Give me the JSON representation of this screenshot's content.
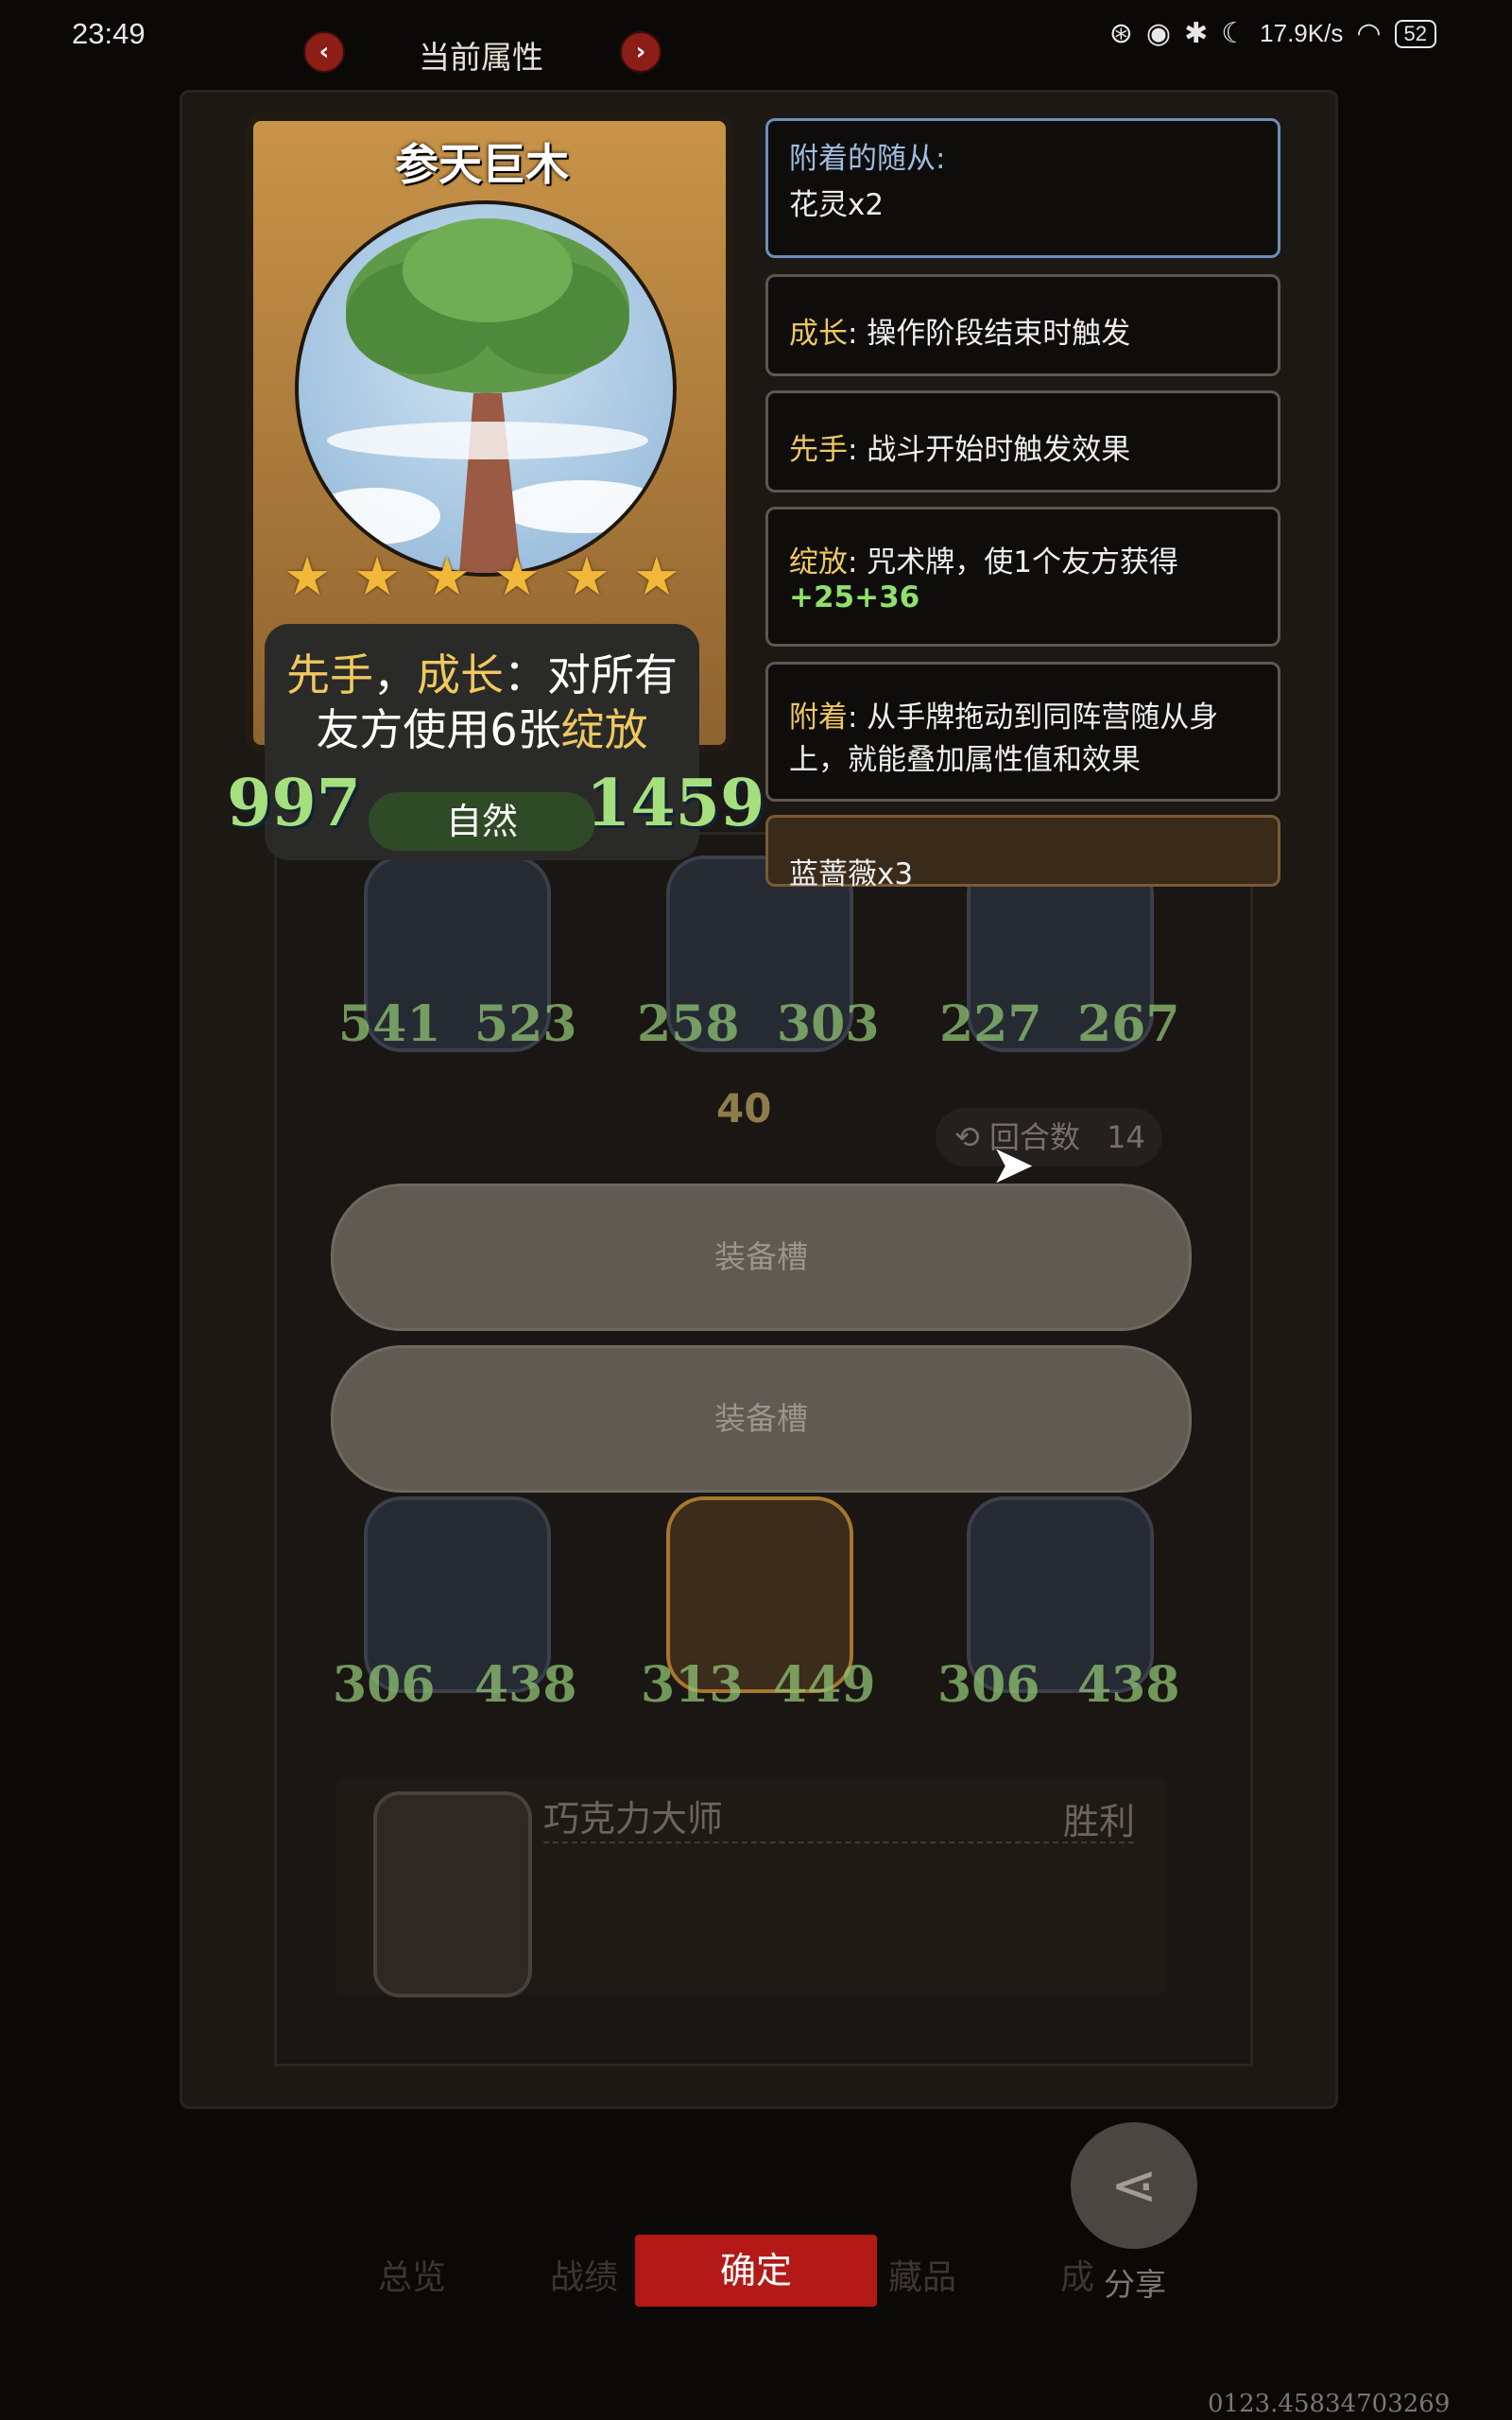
{
  "status_bar": {
    "time": "23:49",
    "net_speed": "17.9K/s",
    "battery": "52"
  },
  "header": {
    "title": "当前属性"
  },
  "card": {
    "name": "参天巨木",
    "star_count": 6,
    "desc_part1": "先手",
    "desc_sep": "，",
    "desc_part2": "成长",
    "desc_part3": "：对所有",
    "desc_part4": "友方使用6张",
    "desc_part5": "绽放",
    "attack": "997",
    "health": "1459",
    "element": "自然"
  },
  "keywords": {
    "attached_title": "附着的随从:",
    "attached_value": "花灵x2",
    "growth_kw": "成长",
    "growth_text": ": 操作阶段结束时触发",
    "first_kw": "先手",
    "first_text": ": 战斗开始时触发效果",
    "bloom_kw": "绽放",
    "bloom_text": ": 咒术牌，使1个友方获得",
    "bloom_buff": "+25+36",
    "attach_kw": "附着",
    "attach_text": ": 从手牌拖动到同阵营随从身上，就能叠加属性值和效果",
    "follower": "蓝蔷薇x3"
  },
  "board": {
    "top_units": [
      {
        "atk": "541",
        "hp": "523"
      },
      {
        "atk": "258",
        "hp": "303"
      },
      {
        "atk": "227",
        "hp": "267"
      }
    ],
    "level": "40",
    "round_label": "回合数",
    "round_value": "14",
    "slot1": "装备槽",
    "slot2": "装备槽",
    "bottom_units": [
      {
        "atk": "306",
        "hp": "438"
      },
      {
        "atk": "313",
        "hp": "449"
      },
      {
        "atk": "306",
        "hp": "438"
      }
    ],
    "opponent_name": "巧克力大师",
    "result": "胜利"
  },
  "bottom": {
    "tab1": "总览",
    "tab2": "战绩",
    "confirm": "确定",
    "tab3": "藏品",
    "tab4": "成",
    "share": "分享",
    "version": "0123.45834703269"
  },
  "colors": {
    "keyword": "#f0c860",
    "stat_green": "#a6e07e",
    "confirm_red": "#b31a17"
  }
}
